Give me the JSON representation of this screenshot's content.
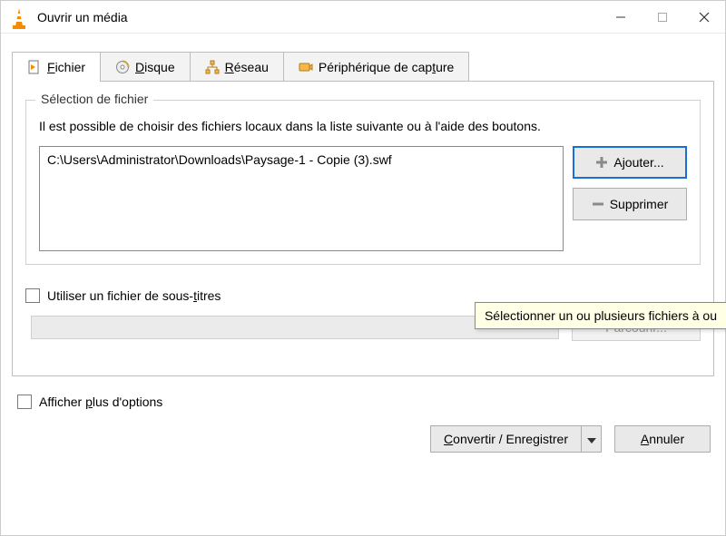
{
  "title": "Ouvrir un média",
  "tabs": {
    "file": {
      "prefix": "F",
      "rest": "ichier"
    },
    "disc": {
      "prefix": "D",
      "rest": "isque"
    },
    "network": {
      "prefix": "R",
      "rest": "éseau"
    },
    "capture": {
      "pre": "Périphérique de cap",
      "u": "t",
      "post": "ure"
    }
  },
  "file_section": {
    "legend": "Sélection de fichier",
    "description": "Il est possible de choisir des fichiers locaux dans la liste suivante ou à l'aide des boutons.",
    "selected_file": "C:\\Users\\Administrator\\Downloads\\Paysage-1 - Copie (3).swf",
    "add_label": "Ajouter...",
    "remove_label": "Supprimer"
  },
  "tooltip": "Sélectionner un ou plusieurs fichiers à ou",
  "subtitle": {
    "pre": "Utiliser un fichier de sous-",
    "u": "t",
    "post": "itres",
    "browse": "Parcourir..."
  },
  "show_more": {
    "pre": "Afficher ",
    "u": "p",
    "post": "lus d'options"
  },
  "footer": {
    "convert": {
      "u": "C",
      "rest": "onvertir / Enregistrer"
    },
    "cancel": {
      "u": "A",
      "rest": "nnuler"
    }
  }
}
